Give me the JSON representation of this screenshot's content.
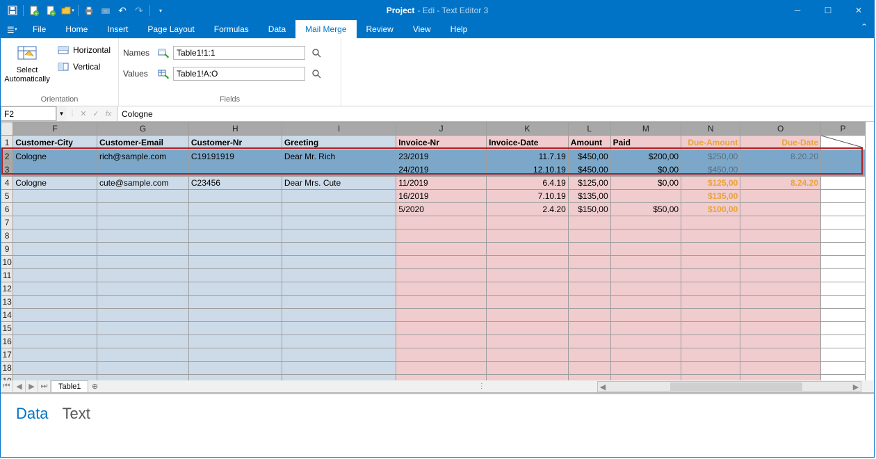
{
  "title": {
    "project": "Project",
    "rest": "- Edi - Text Editor 3"
  },
  "menu": [
    "File",
    "Home",
    "Insert",
    "Page Layout",
    "Formulas",
    "Data",
    "Mail Merge",
    "Review",
    "View",
    "Help"
  ],
  "menu_active": "Mail Merge",
  "ribbon": {
    "orientation": {
      "select_auto": "Select\nAutomatically",
      "horizontal": "Horizontal",
      "vertical": "Vertical",
      "label": "Orientation"
    },
    "fields": {
      "names_label": "Names",
      "values_label": "Values",
      "names_value": "Table1!1:1",
      "values_value": "Table1!A:O",
      "label": "Fields"
    }
  },
  "namebox": "F2",
  "formula": "Cologne",
  "columns": [
    {
      "letter": "F",
      "w": 119,
      "header": "Customer-City",
      "zone": "blue"
    },
    {
      "letter": "G",
      "w": 130,
      "header": "Customer-Email",
      "zone": "blue"
    },
    {
      "letter": "H",
      "w": 132,
      "header": "Customer-Nr",
      "zone": "blue"
    },
    {
      "letter": "I",
      "w": 162,
      "header": "Greeting",
      "zone": "blue"
    },
    {
      "letter": "J",
      "w": 128,
      "header": "Invoice-Nr",
      "zone": "pink"
    },
    {
      "letter": "K",
      "w": 116,
      "header": "Invoice-Date",
      "zone": "pink",
      "align": "right"
    },
    {
      "letter": "L",
      "w": 60,
      "header": "Amount",
      "zone": "pink",
      "align": "right"
    },
    {
      "letter": "M",
      "w": 100,
      "header": "Paid",
      "zone": "pink",
      "align": "right"
    },
    {
      "letter": "N",
      "w": 84,
      "header": "Due-Amount",
      "zone": "pink",
      "due": true,
      "align": "right"
    },
    {
      "letter": "O",
      "w": 114,
      "header": "Due-Date",
      "zone": "pink",
      "due": true,
      "align": "right"
    },
    {
      "letter": "P",
      "w": 63,
      "header": "",
      "zone": "none"
    }
  ],
  "rows": [
    {
      "n": 2,
      "sel": true,
      "cells": [
        "Cologne",
        "rich@sample.com",
        "C19191919",
        "Dear Mr. Rich",
        "23/2019",
        "11.7.19",
        "$450,00",
        "$200,00",
        "$250,00",
        "8.20.20",
        ""
      ]
    },
    {
      "n": 3,
      "sel": true,
      "cells": [
        "",
        "",
        "",
        "",
        "24/2019",
        "12.10.19",
        "$450,00",
        "$0,00",
        "$450,00",
        "",
        ""
      ]
    },
    {
      "n": 4,
      "cells": [
        "Cologne",
        "cute@sample.com",
        "C23456",
        "Dear Mrs. Cute",
        "11/2019",
        "6.4.19",
        "$125,00",
        "$0,00",
        "$125,00",
        "8.24.20",
        ""
      ],
      "due_orange": true
    },
    {
      "n": 5,
      "cells": [
        "",
        "",
        "",
        "",
        "16/2019",
        "7.10.19",
        "$135,00",
        "",
        "$135,00",
        "",
        ""
      ],
      "due_orange": true
    },
    {
      "n": 6,
      "cells": [
        "",
        "",
        "",
        "",
        "5/2020",
        "2.4.20",
        "$150,00",
        "$50,00",
        "$100,00",
        "",
        ""
      ],
      "due_orange": true
    },
    {
      "n": 7,
      "cells": [
        "",
        "",
        "",
        "",
        "",
        "",
        "",
        "",
        "",
        "",
        ""
      ]
    },
    {
      "n": 8,
      "cells": [
        "",
        "",
        "",
        "",
        "",
        "",
        "",
        "",
        "",
        "",
        ""
      ]
    },
    {
      "n": 9,
      "cells": [
        "",
        "",
        "",
        "",
        "",
        "",
        "",
        "",
        "",
        "",
        ""
      ]
    },
    {
      "n": 10,
      "cells": [
        "",
        "",
        "",
        "",
        "",
        "",
        "",
        "",
        "",
        "",
        ""
      ]
    },
    {
      "n": 11,
      "cells": [
        "",
        "",
        "",
        "",
        "",
        "",
        "",
        "",
        "",
        "",
        ""
      ]
    },
    {
      "n": 12,
      "cells": [
        "",
        "",
        "",
        "",
        "",
        "",
        "",
        "",
        "",
        "",
        ""
      ]
    },
    {
      "n": 13,
      "cells": [
        "",
        "",
        "",
        "",
        "",
        "",
        "",
        "",
        "",
        "",
        ""
      ]
    },
    {
      "n": 14,
      "cells": [
        "",
        "",
        "",
        "",
        "",
        "",
        "",
        "",
        "",
        "",
        ""
      ]
    },
    {
      "n": 15,
      "cells": [
        "",
        "",
        "",
        "",
        "",
        "",
        "",
        "",
        "",
        "",
        ""
      ]
    },
    {
      "n": 16,
      "cells": [
        "",
        "",
        "",
        "",
        "",
        "",
        "",
        "",
        "",
        "",
        ""
      ]
    },
    {
      "n": 17,
      "cells": [
        "",
        "",
        "",
        "",
        "",
        "",
        "",
        "",
        "",
        "",
        ""
      ]
    },
    {
      "n": 18,
      "cells": [
        "",
        "",
        "",
        "",
        "",
        "",
        "",
        "",
        "",
        "",
        ""
      ]
    },
    {
      "n": 19,
      "cells": [
        "",
        "",
        "",
        "",
        "",
        "",
        "",
        "",
        "",
        "",
        ""
      ]
    }
  ],
  "sheet_tab": "Table1",
  "mode_tabs": {
    "data": "Data",
    "text": "Text"
  }
}
